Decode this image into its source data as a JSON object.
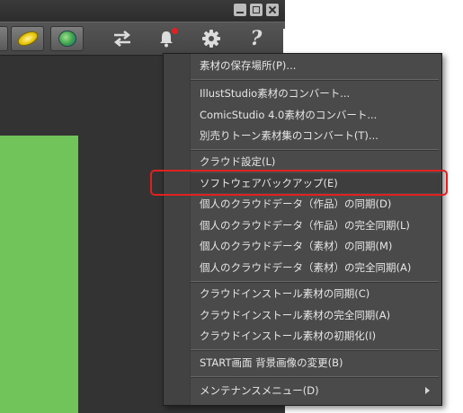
{
  "window": {
    "icons": {
      "minimize": "minimize-icon",
      "maximize": "maximize-icon",
      "close": "close-icon"
    }
  },
  "toolbar": {
    "icons": [
      "gold-coin-icon",
      "world-material-icon",
      "sync-arrows-icon",
      "notification-bell-icon",
      "gear-icon",
      "help-icon"
    ],
    "help_glyph": "?",
    "notification_badge_color": "#e32020"
  },
  "colors": {
    "menu_background": "#4a4a4a",
    "menu_text": "#e6e6e6",
    "highlight_border": "#e02020",
    "preview_green": "#70c45a"
  },
  "menu": {
    "items": [
      {
        "label": "素材の保存場所(P)..."
      },
      {
        "label": "IllustStudio素材のコンバート..."
      },
      {
        "label": "ComicStudio 4.0素材のコンバート..."
      },
      {
        "label": "別売りトーン素材集のコンバート(T)..."
      },
      {
        "label": "クラウド設定(L)"
      },
      {
        "label": "ソフトウェアバックアップ(E)"
      },
      {
        "label": "個人のクラウドデータ（作品）の同期(D)"
      },
      {
        "label": "個人のクラウドデータ（作品）の完全同期(L)"
      },
      {
        "label": "個人のクラウドデータ（素材）の同期(M)"
      },
      {
        "label": "個人のクラウドデータ（素材）の完全同期(A)"
      },
      {
        "label": "クラウドインストール素材の同期(C)"
      },
      {
        "label": "クラウドインストール素材の完全同期(A)"
      },
      {
        "label": "クラウドインストール素材の初期化(I)"
      },
      {
        "label": "START画面 背景画像の変更(B)"
      },
      {
        "label": "メンテナンスメニュー(D)"
      }
    ]
  }
}
